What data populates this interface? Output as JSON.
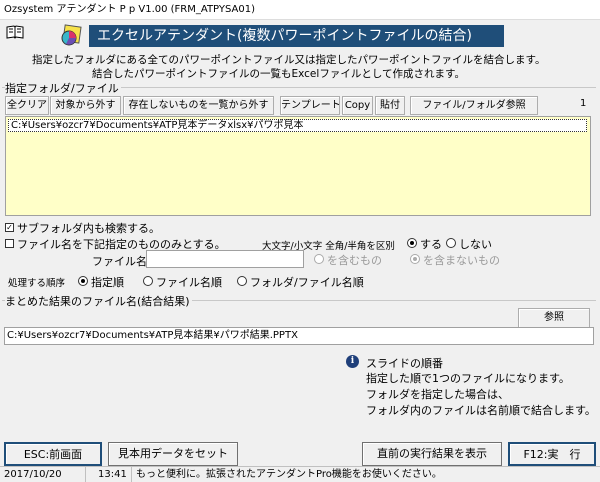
{
  "window": {
    "title": "Ozsystem アテンダント P p V1.00 (FRM_ATPYSA01)"
  },
  "header": {
    "banner_title": "エクセルアテンダント(複数パワーポイントファイルの結合)",
    "description_line1": "指定したフォルダにある全てのパワーポイントファイル又は指定したパワーポイントファイルを結合します。",
    "description_line2": "結合したパワーポイントファイルの一覧もExcelファイルとして作成されます。"
  },
  "folder_group": {
    "label": "指定フォルダ/ファイル",
    "count": "1",
    "toolbar": {
      "clear_all": "全クリア",
      "exclude_target": "対象から外す",
      "exclude_missing": "存在しないものを一覧から外す",
      "template": "テンプレート",
      "copy": "Copy",
      "paste": "貼付",
      "browse": "ファイル/フォルダ参照"
    },
    "items": [
      "C:¥Users¥ozcr7¥Documents¥ATP見本データxlsx¥パワポ見本"
    ]
  },
  "options": {
    "include_subfolders_label": "サブフォルダ内も検索する。",
    "include_subfolders_checked": true,
    "filter_by_name_label": "ファイル名を下記指定のもののみとする。",
    "filter_by_name_checked": false,
    "case_label": "大文字/小文字 全角/半角を区別",
    "case_yes": "する",
    "case_no": "しない",
    "filename_label": "ファイル名に",
    "filename_value": "",
    "contains": "を含むもの",
    "not_contains": "を含まないもの",
    "order_label": "処理する順序",
    "order_specified": "指定順",
    "order_filename": "ファイル名順",
    "order_folder_filename": "フォルダ/ファイル名順"
  },
  "result_group": {
    "label": "まとめた結果のファイル名(結合結果)",
    "browse": "参照",
    "path": "C:¥Users¥ozcr7¥Documents¥ATP見本結果¥パワポ結果.PPTX"
  },
  "info": {
    "title": "スライドの順番",
    "line1": "指定した順で1つのファイルになります。",
    "line2": "フォルダを指定した場合は、",
    "line3": "フォルダ内のファイルは名前順で結合します。"
  },
  "footer": {
    "esc_button": "ESC:前画面",
    "sample_button": "見本用データをセット",
    "last_result_button": "直前の実行結果を表示",
    "execute_button": "F12:実　行"
  },
  "status": {
    "date": "2017/10/20",
    "time": "13:41",
    "message": "もっと便利に。拡張されたアテンダントPro機能をお使いください。"
  },
  "colors": {
    "banner": "#1f4e79",
    "list_bg": "#ffffc8"
  }
}
